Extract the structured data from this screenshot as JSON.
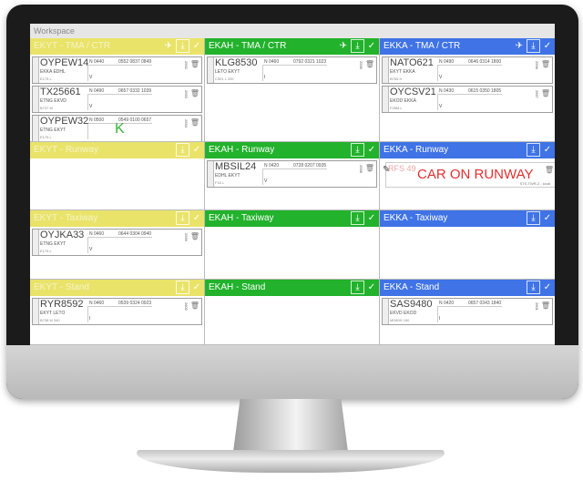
{
  "colors": {
    "yellow": "#eae36a",
    "green": "#22b22c",
    "blue": "#3f73e6",
    "warning": "#e03030"
  },
  "topbar": {
    "title": "Workspace"
  },
  "panes": [
    {
      "title": "EKYT - TMA / CTR",
      "color": "yellow",
      "icons": [
        "plane-icon",
        "download-icon",
        "check-icon"
      ],
      "strips": [
        {
          "cs": "OYPEW14",
          "route": "EKKA    EDHL",
          "type": "E175 L",
          "n": "N 0440",
          "times": "0552 0837 0849",
          "v": "V",
          "side": "2592"
        },
        {
          "cs": "TX25661",
          "route": "ETNG    EKVD",
          "type": "B737 M",
          "n": "N 0490",
          "times": "0657 0332 1039",
          "v": "V",
          "side": "2593"
        },
        {
          "cs": "OYPEW32",
          "route": "ETNG    EKYT",
          "type": "E175 L",
          "n": "N 0500",
          "times": "0549 0100 0657",
          "v": "",
          "side": "2594",
          "mark": "K"
        }
      ]
    },
    {
      "title": "EKAH - TMA / CTR",
      "color": "green",
      "icons": [
        "plane-icon",
        "download-icon",
        "check-icon"
      ],
      "strips": [
        {
          "cs": "KLG8530",
          "route": "LETO    EKYT",
          "type": "C501 L   200",
          "n": "N 0460",
          "times": "0792 0321 1023",
          "v": "I",
          "side": "2595"
        }
      ]
    },
    {
      "title": "EKKA - TMA / CTR",
      "color": "blue",
      "icons": [
        "plane-icon",
        "download-icon",
        "check-icon"
      ],
      "strips": [
        {
          "cs": "NATO621",
          "route": "EKYT    EKKA",
          "type": "B765 H",
          "n": "N 0490",
          "times": "0646 0314 1800",
          "v": "V",
          "side": "2596"
        },
        {
          "cs": "OYCSV21",
          "route": "EKOD    EKKA",
          "type": "F28M L",
          "n": "N 0430",
          "times": "0615 0350 1805",
          "v": "V",
          "side": "2597"
        }
      ]
    },
    {
      "title": "EKYT - Runway",
      "color": "yellow",
      "icons": [
        "download-icon",
        "check-icon"
      ],
      "strips": []
    },
    {
      "title": "EKAH - Runway",
      "color": "green",
      "icons": [
        "download-icon",
        "check-icon"
      ],
      "strips": [
        {
          "cs": "MBSIL24",
          "route": "EDHL    EKYT",
          "type": "F16   L",
          "n": "N 0420",
          "times": "0728 0207 0935",
          "v": "V",
          "side": "2598"
        }
      ]
    },
    {
      "title": "EKKA - Runway",
      "color": "blue",
      "icons": [
        "download-icon",
        "check-icon"
      ],
      "strips": [],
      "note": {
        "scrib": "RFS 49",
        "warning": "CAR ON RUNWAY",
        "tag": "STS-TWR-2 - local"
      }
    },
    {
      "title": "EKYT - Taxiway",
      "color": "yellow",
      "icons": [
        "download-icon",
        "check-icon"
      ],
      "strips": [
        {
          "cs": "OYJKA33",
          "route": "ETNG    EKYT",
          "type": "E175 L",
          "n": "N 0460",
          "times": "0644 0304 0940",
          "v": "V",
          "side": "2599"
        }
      ]
    },
    {
      "title": "EKAH - Taxiway",
      "color": "green",
      "icons": [
        "download-icon",
        "check-icon"
      ],
      "strips": []
    },
    {
      "title": "EKKA - Taxiway",
      "color": "blue",
      "icons": [
        "download-icon",
        "check-icon"
      ],
      "strips": []
    },
    {
      "title": "EKYT - Stand",
      "color": "yellow",
      "icons": [
        "download-icon",
        "check-icon"
      ],
      "strips": [
        {
          "cs": "RYR8592",
          "route": "EKYT    LETO",
          "type": "B738 M   340",
          "n": "N 0460",
          "times": "0539 0324 0923",
          "v": "I",
          "side": "2600"
        }
      ]
    },
    {
      "title": "EKAH - Stand",
      "color": "green",
      "icons": [
        "download-icon",
        "check-icon"
      ],
      "strips": []
    },
    {
      "title": "EKKA - Stand",
      "color": "blue",
      "icons": [
        "download-icon",
        "check-icon"
      ],
      "strips": [
        {
          "cs": "SAS9480",
          "route": "EKVD    EKOD",
          "type": "MD80H   180",
          "n": "N 0420",
          "times": "0657 0343 1840",
          "v": "I",
          "side": "2601"
        }
      ]
    }
  ]
}
